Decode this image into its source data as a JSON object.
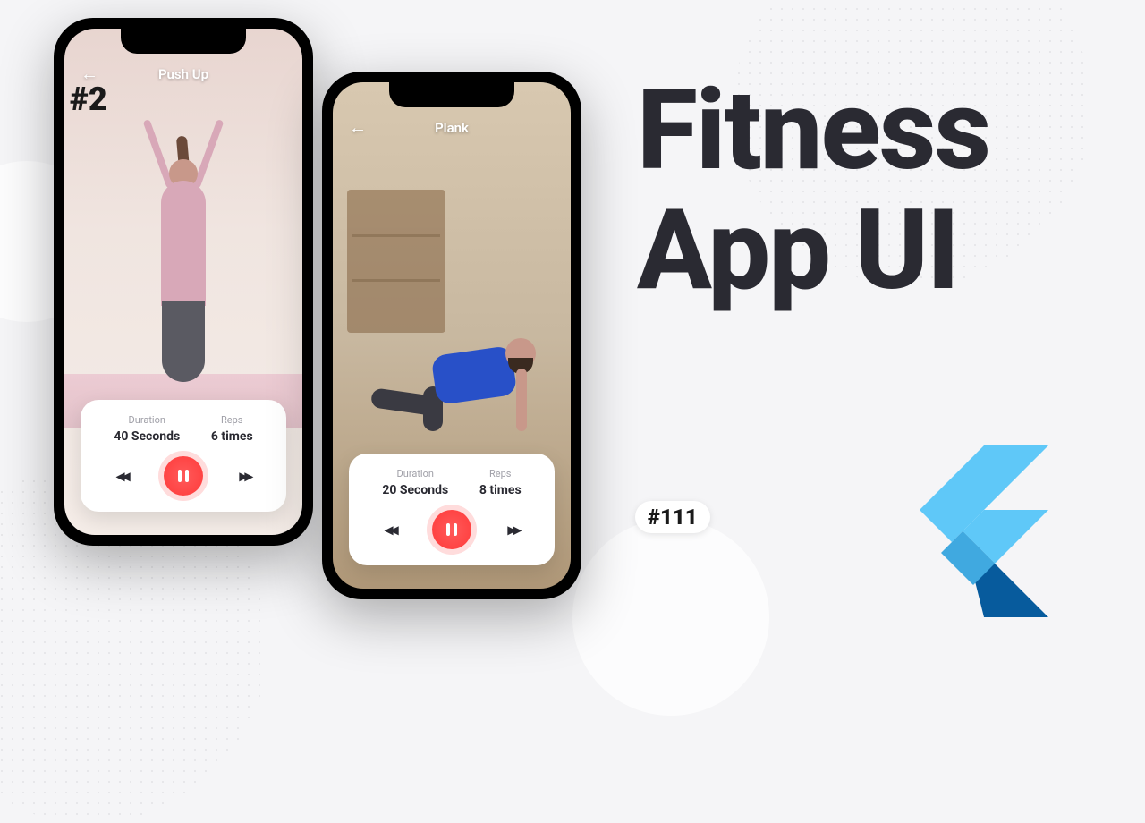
{
  "badges": {
    "episode": "#2",
    "video": "#111"
  },
  "headline": {
    "line1": "Fitness",
    "line2": "App UI"
  },
  "phones": [
    {
      "title": "Push Up",
      "duration_label": "Duration",
      "duration_value": "40 Seconds",
      "reps_label": "Reps",
      "reps_value": "6 times"
    },
    {
      "title": "Plank",
      "duration_label": "Duration",
      "duration_value": "20 Seconds",
      "reps_label": "Reps",
      "reps_value": "8 times"
    }
  ]
}
